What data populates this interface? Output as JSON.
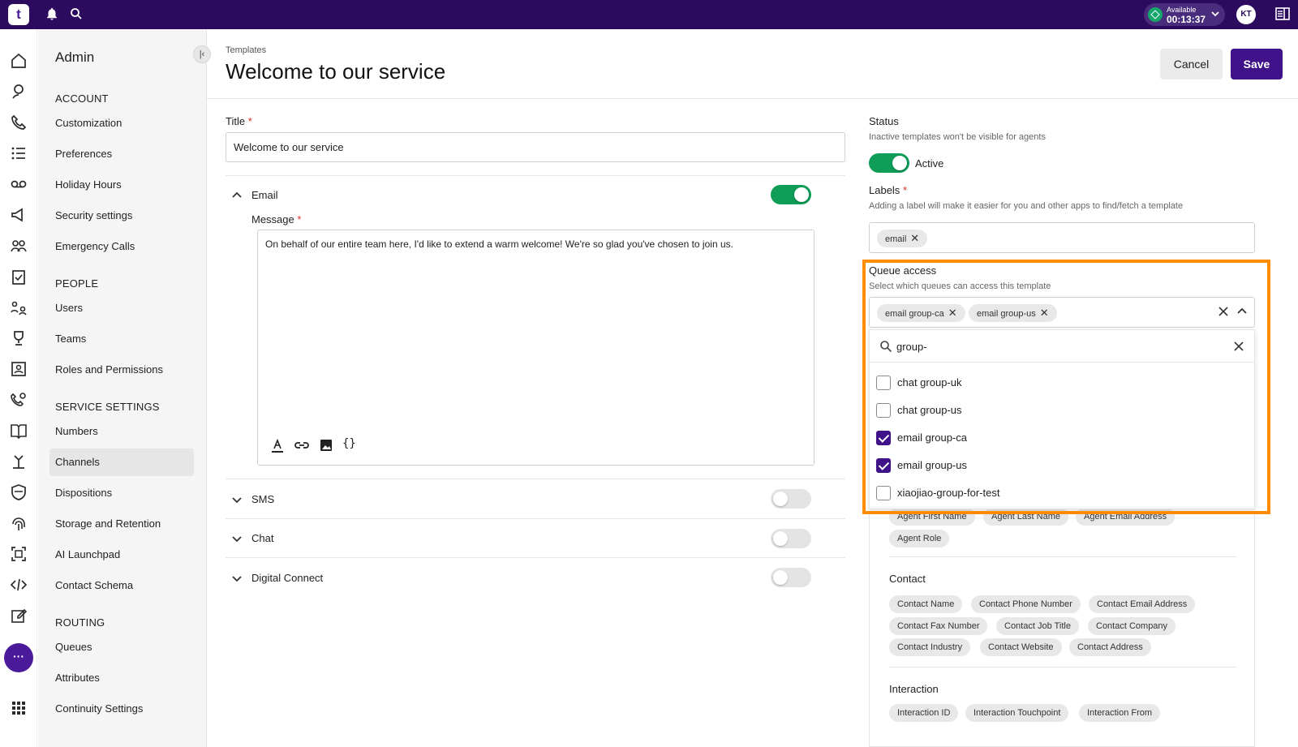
{
  "topbar": {
    "logo_text": "t",
    "status": {
      "label": "Available",
      "time": "00:13:37"
    },
    "avatar_initials": "KT"
  },
  "rail": {
    "more_label": "···",
    "icons": [
      "home-icon",
      "contacts-icon",
      "phone-icon",
      "list-icon",
      "voicemail-icon",
      "megaphone-icon",
      "team-icon",
      "clipboard-icon",
      "people-network-icon",
      "trophy-icon",
      "contact-card-icon",
      "settings-phone-icon",
      "book-icon",
      "routing-icon",
      "shield-icon",
      "fingerprint-icon",
      "scan-icon",
      "code-icon",
      "edit-icon",
      "more-icon",
      "apps-grid-icon"
    ]
  },
  "sidenav": {
    "title": "Admin",
    "sections": [
      {
        "heading": "ACCOUNT",
        "items": [
          "Customization",
          "Preferences",
          "Holiday Hours",
          "Security settings",
          "Emergency Calls"
        ]
      },
      {
        "heading": "PEOPLE",
        "items": [
          "Users",
          "Teams",
          "Roles and Permissions"
        ]
      },
      {
        "heading": "SERVICE SETTINGS",
        "items": [
          "Numbers",
          "Channels",
          "Dispositions",
          "Storage and Retention",
          "AI Launchpad",
          "Contact Schema"
        ]
      },
      {
        "heading": "ROUTING",
        "items": [
          "Queues",
          "Attributes",
          "Continuity Settings"
        ]
      }
    ],
    "active_item": "Channels"
  },
  "header": {
    "breadcrumb": "Templates",
    "title": "Welcome to our service",
    "cancel_label": "Cancel",
    "save_label": "Save"
  },
  "form": {
    "title_label": "Title",
    "required_mark": "*",
    "title_value": "Welcome to our service",
    "channels": [
      {
        "label": "Email",
        "expanded": true,
        "enabled": true
      },
      {
        "label": "SMS",
        "expanded": false,
        "enabled": false
      },
      {
        "label": "Chat",
        "expanded": false,
        "enabled": false
      },
      {
        "label": "Digital Connect",
        "expanded": false,
        "enabled": false
      }
    ],
    "message_label": "Message",
    "message_value": "On behalf of our entire team here, I'd like to extend a warm welcome! We're so glad you've chosen to join us."
  },
  "status": {
    "label": "Status",
    "help": "Inactive templates won't be visible for agents",
    "toggle_label": "Active",
    "active": true
  },
  "labels": {
    "label": "Labels",
    "help": "Adding a label will make it easier for you and other apps to find/fetch a template",
    "chips": [
      "email"
    ]
  },
  "queue_access": {
    "label": "Queue access",
    "help": "Select which queues can access this template",
    "selected_chips": [
      "email group-ca",
      "email group-us"
    ],
    "search_value": "group-",
    "options": [
      {
        "label": "chat group-uk",
        "checked": false
      },
      {
        "label": "chat group-us",
        "checked": false
      },
      {
        "label": "email group-ca",
        "checked": true
      },
      {
        "label": "email group-us",
        "checked": true
      },
      {
        "label": "xiaojiao-group-for-test",
        "checked": false
      }
    ]
  },
  "variables": {
    "agent_chips": [
      "Agent First Name",
      "Agent Last Name",
      "Agent Email Address",
      "Agent Role"
    ],
    "contact_title": "Contact",
    "contact_chips": [
      "Contact Name",
      "Contact Phone Number",
      "Contact Email Address",
      "Contact Fax Number",
      "Contact Job Title",
      "Contact Company",
      "Contact Industry",
      "Contact Website",
      "Contact Address"
    ],
    "interaction_title": "Interaction",
    "interaction_chips": [
      "Interaction ID",
      "Interaction Touchpoint",
      "Interaction From"
    ]
  },
  "colors": {
    "topbar": "#2c0b5f",
    "primary": "#3f1289",
    "toggle_on": "#0f9d58",
    "highlight": "#ff8c00"
  }
}
